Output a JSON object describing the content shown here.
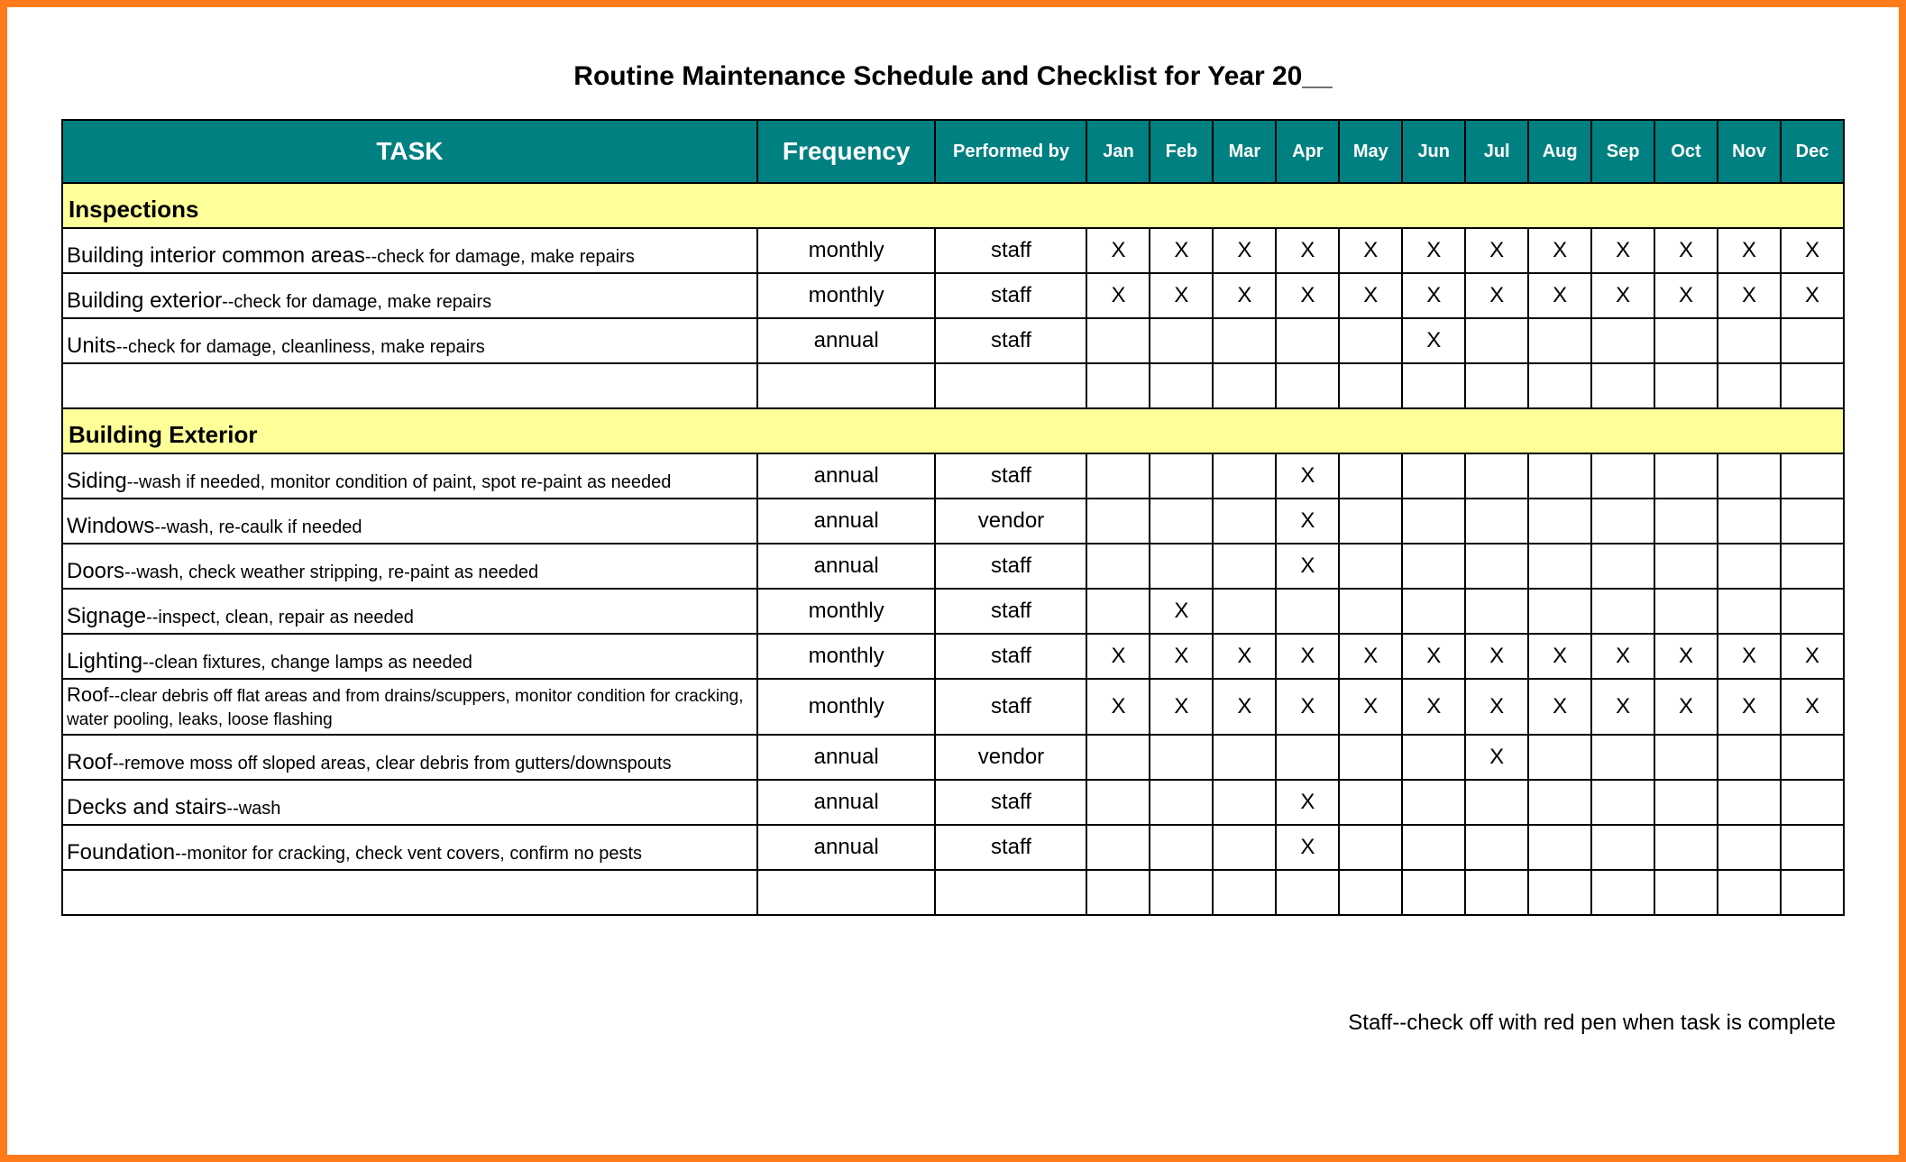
{
  "title": "Routine Maintenance Schedule and Checklist for Year 20__",
  "headers": {
    "task": "TASK",
    "frequency": "Frequency",
    "performed_by": "Performed by",
    "months": [
      "Jan",
      "Feb",
      "Mar",
      "Apr",
      "May",
      "Jun",
      "Jul",
      "Aug",
      "Sep",
      "Oct",
      "Nov",
      "Dec"
    ]
  },
  "sections": [
    {
      "name": "Inspections",
      "rows": [
        {
          "task_strong": "Building interior common areas",
          "task_detail": "--check for damage, make repairs",
          "frequency": "monthly",
          "performed_by": "staff",
          "months": [
            "X",
            "X",
            "X",
            "X",
            "X",
            "X",
            "X",
            "X",
            "X",
            "X",
            "X",
            "X"
          ]
        },
        {
          "task_strong": "Building exterior",
          "task_detail": "--check for damage, make repairs",
          "frequency": "monthly",
          "performed_by": "staff",
          "months": [
            "X",
            "X",
            "X",
            "X",
            "X",
            "X",
            "X",
            "X",
            "X",
            "X",
            "X",
            "X"
          ]
        },
        {
          "task_strong": "Units",
          "task_detail": "--check for damage, cleanliness, make repairs",
          "frequency": "annual",
          "performed_by": "staff",
          "months": [
            "",
            "",
            "",
            "",
            "",
            "X",
            "",
            "",
            "",
            "",
            "",
            ""
          ]
        },
        {
          "task_strong": "",
          "task_detail": "",
          "frequency": "",
          "performed_by": "",
          "months": [
            "",
            "",
            "",
            "",
            "",
            "",
            "",
            "",
            "",
            "",
            "",
            ""
          ]
        }
      ]
    },
    {
      "name": "Building Exterior",
      "rows": [
        {
          "task_strong": "Siding",
          "task_detail": "--wash if needed, monitor condition of paint, spot re-paint as needed",
          "frequency": "annual",
          "performed_by": "staff",
          "months": [
            "",
            "",
            "",
            "X",
            "",
            "",
            "",
            "",
            "",
            "",
            "",
            ""
          ]
        },
        {
          "task_strong": "Windows",
          "task_detail": "--wash, re-caulk if needed",
          "frequency": "annual",
          "performed_by": "vendor",
          "months": [
            "",
            "",
            "",
            "X",
            "",
            "",
            "",
            "",
            "",
            "",
            "",
            ""
          ]
        },
        {
          "task_strong": "Doors",
          "task_detail": "--wash, check weather stripping, re-paint as needed",
          "frequency": "annual",
          "performed_by": "staff",
          "months": [
            "",
            "",
            "",
            "X",
            "",
            "",
            "",
            "",
            "",
            "",
            "",
            ""
          ]
        },
        {
          "task_strong": "Signage",
          "task_detail": "--inspect, clean, repair as needed",
          "frequency": "monthly",
          "performed_by": "staff",
          "months": [
            "",
            "X",
            "",
            "",
            "",
            "",
            "",
            "",
            "",
            "",
            "",
            ""
          ]
        },
        {
          "task_strong": "Lighting",
          "task_detail": "--clean fixtures, change lamps as needed",
          "frequency": "monthly",
          "performed_by": "staff",
          "months": [
            "X",
            "X",
            "X",
            "X",
            "X",
            "X",
            "X",
            "X",
            "X",
            "X",
            "X",
            "X"
          ]
        },
        {
          "task_strong": "Roof",
          "task_detail": "--clear debris off flat areas and from drains/scuppers, monitor condition for cracking, water pooling, leaks, loose flashing",
          "frequency": "monthly",
          "performed_by": "staff",
          "months": [
            "X",
            "X",
            "X",
            "X",
            "X",
            "X",
            "X",
            "X",
            "X",
            "X",
            "X",
            "X"
          ],
          "multi_line": true
        },
        {
          "task_strong": "Roof",
          "task_detail": "--remove moss off sloped areas, clear debris from gutters/downspouts",
          "frequency": "annual",
          "performed_by": "vendor",
          "months": [
            "",
            "",
            "",
            "",
            "",
            "",
            "X",
            "",
            "",
            "",
            "",
            ""
          ]
        },
        {
          "task_strong": "Decks and stairs",
          "task_detail": "--wash",
          "frequency": "annual",
          "performed_by": "staff",
          "months": [
            "",
            "",
            "",
            "X",
            "",
            "",
            "",
            "",
            "",
            "",
            "",
            ""
          ]
        },
        {
          "task_strong": "Foundation",
          "task_detail": "--monitor for cracking, check vent covers, confirm no pests",
          "frequency": "annual",
          "performed_by": "staff",
          "months": [
            "",
            "",
            "",
            "X",
            "",
            "",
            "",
            "",
            "",
            "",
            "",
            ""
          ]
        },
        {
          "task_strong": "",
          "task_detail": "",
          "frequency": "",
          "performed_by": "",
          "months": [
            "",
            "",
            "",
            "",
            "",
            "",
            "",
            "",
            "",
            "",
            "",
            ""
          ]
        }
      ]
    }
  ],
  "footnote": "Staff--check off with red pen when task is complete"
}
